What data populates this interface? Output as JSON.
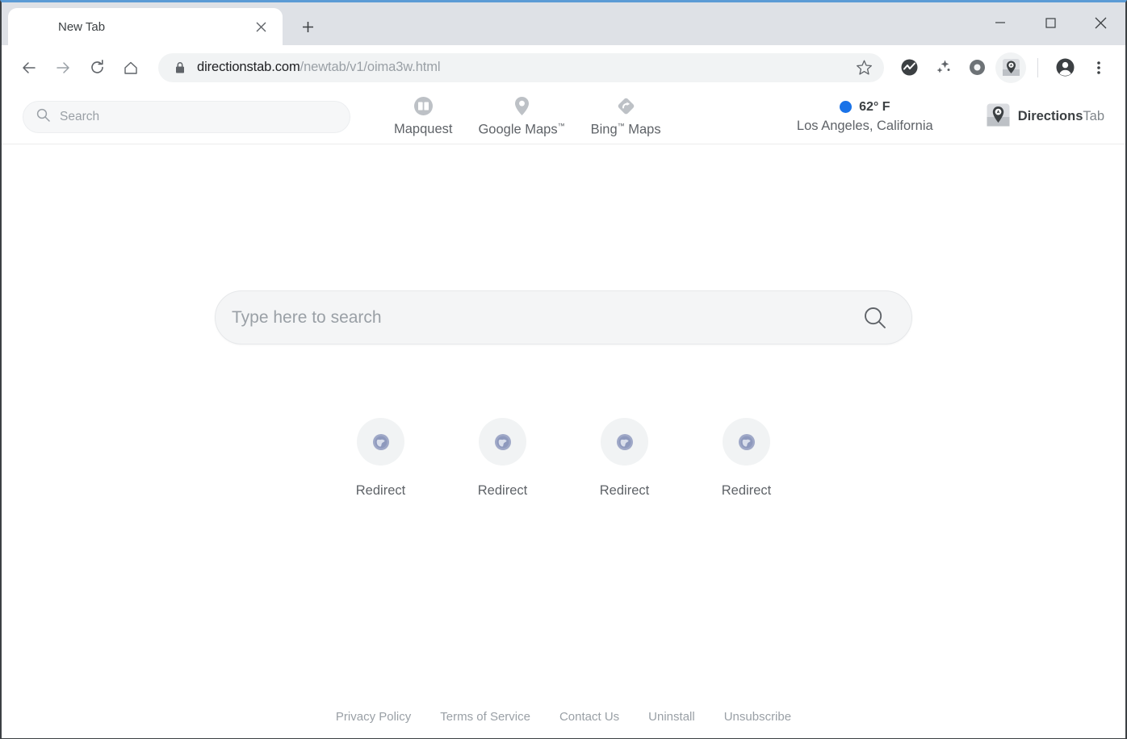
{
  "browser": {
    "tab": {
      "title": "New Tab",
      "close_label": "×"
    },
    "newtab_label": "+",
    "omnibox": {
      "url_domain": "directionstab.com",
      "url_path": "/newtab/v1/oima3w.html",
      "full_url": "directionstab.com/newtab/v1/oima3w.html"
    },
    "nav_buttons": [
      "back-icon",
      "forward-icon",
      "reload-icon",
      "home-icon"
    ],
    "toolbar_icons": [
      "bookmark-star-icon",
      "activity-extension-icon",
      "sparkles-extension-icon",
      "ring-extension-icon",
      "directionstab-extension-icon",
      "profile-avatar-icon",
      "chrome-menu-icon"
    ],
    "window_controls": {
      "minimize": "—",
      "maximize": "□",
      "close": "×"
    }
  },
  "header": {
    "search": {
      "placeholder": "Search",
      "value": ""
    },
    "nav": [
      {
        "label": "Mapquest",
        "icon": "mapquest-book-icon",
        "tm": ""
      },
      {
        "label": "Google Maps",
        "icon": "google-maps-pin-icon",
        "tm": "™"
      },
      {
        "label": "Bing",
        "label2": " Maps",
        "icon": "bing-maps-diamond-icon",
        "tm": "™"
      }
    ],
    "weather": {
      "temperature": "62° F",
      "location": "Los Angeles, California",
      "dot_color": "#1a73e8"
    },
    "brand": {
      "bold": "Directions",
      "light": "Tab",
      "icon": "directionstab-logo-icon"
    }
  },
  "main": {
    "search": {
      "placeholder": "Type here to search",
      "value": "",
      "icon": "search-icon"
    },
    "tiles": [
      {
        "label": "Redirect",
        "icon": "globe-favicon"
      },
      {
        "label": "Redirect",
        "icon": "globe-favicon"
      },
      {
        "label": "Redirect",
        "icon": "globe-favicon"
      },
      {
        "label": "Redirect",
        "icon": "globe-favicon"
      }
    ]
  },
  "footer": {
    "links": [
      {
        "label": "Privacy Policy"
      },
      {
        "label": "Terms of Service"
      },
      {
        "label": "Contact Us"
      },
      {
        "label": "Uninstall"
      },
      {
        "label": "Unsubscribe"
      }
    ]
  }
}
